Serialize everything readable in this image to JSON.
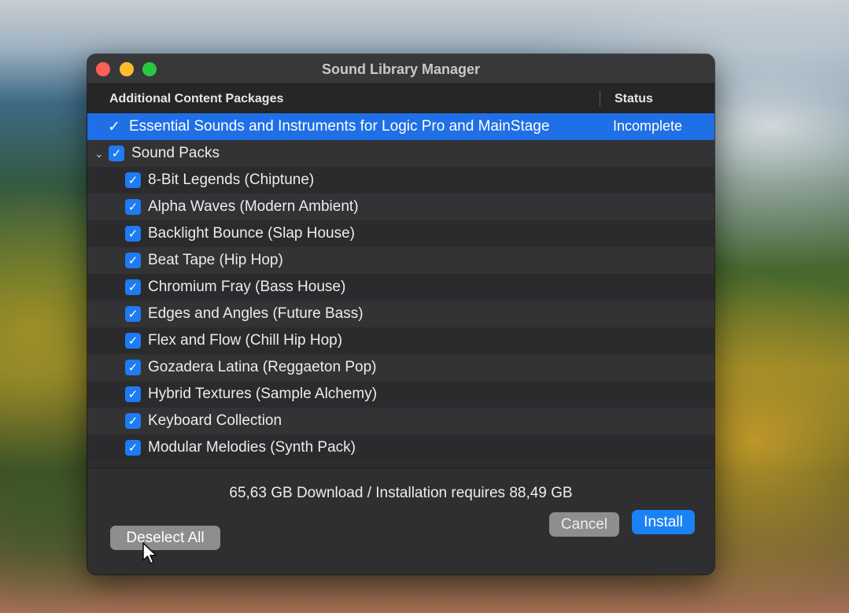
{
  "window": {
    "title": "Sound Library Manager"
  },
  "columns": {
    "packages": "Additional Content Packages",
    "status": "Status"
  },
  "essential": {
    "label": "Essential Sounds and Instruments for Logic Pro and MainStage",
    "status": "Incomplete",
    "checked": true
  },
  "sound_packs": {
    "label": "Sound Packs",
    "checked": true,
    "expanded": true,
    "items": [
      {
        "label": "8-Bit Legends (Chiptune)",
        "checked": true
      },
      {
        "label": "Alpha Waves (Modern Ambient)",
        "checked": true
      },
      {
        "label": "Backlight Bounce (Slap House)",
        "checked": true
      },
      {
        "label": "Beat Tape (Hip Hop)",
        "checked": true
      },
      {
        "label": "Chromium Fray (Bass House)",
        "checked": true
      },
      {
        "label": "Edges and Angles (Future Bass)",
        "checked": true
      },
      {
        "label": "Flex and Flow (Chill Hip Hop)",
        "checked": true
      },
      {
        "label": "Gozadera Latina (Reggaeton Pop)",
        "checked": true
      },
      {
        "label": "Hybrid Textures (Sample Alchemy)",
        "checked": true
      },
      {
        "label": "Keyboard Collection",
        "checked": true
      },
      {
        "label": "Modular Melodies (Synth Pack)",
        "checked": true
      }
    ]
  },
  "footer": {
    "summary": "65,63 GB Download / Installation requires 88,49 GB",
    "deselect_label": "Deselect All",
    "cancel_label": "Cancel",
    "install_label": "Install"
  },
  "icons": {
    "check": "✓",
    "disclosure": "⌄"
  },
  "colors": {
    "accent": "#1f6fe6",
    "checkbox": "#1d7cf2",
    "install_button": "#1b82f5"
  }
}
